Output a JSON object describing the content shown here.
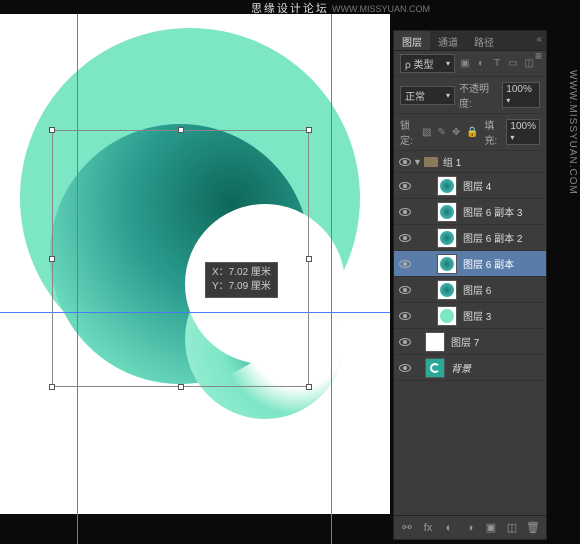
{
  "watermark": {
    "main": "思缘设计论坛",
    "sub": "WWW.MISSYUAN.COM",
    "side": "WWW.MISSYUAN.COM"
  },
  "transform_info": {
    "x_label": "X：7.02 厘米",
    "y_label": "Y：7.09 厘米"
  },
  "panel": {
    "tabs": [
      "图层",
      "通道",
      "路径"
    ],
    "kind_label": "ρ 类型",
    "blend_mode": "正常",
    "opacity_label": "不透明度:",
    "opacity_value": "100%",
    "lock_label": "锁定:",
    "fill_label": "填充:",
    "fill_value": "100%",
    "group_name": "组 1",
    "layers": [
      {
        "name": "图层 4",
        "thumb": "gradient"
      },
      {
        "name": "图层 6 副本 3",
        "thumb": "teal"
      },
      {
        "name": "图层 6 副本 2",
        "thumb": "teal"
      },
      {
        "name": "图层 6 副本",
        "thumb": "teal",
        "selected": true
      },
      {
        "name": "图层 6",
        "thumb": "teal"
      },
      {
        "name": "图层 3",
        "thumb": "lightteal"
      }
    ],
    "outside_layers": [
      {
        "name": "图层 7",
        "thumb": "white"
      },
      {
        "name": "背景",
        "thumb": "swirl",
        "locked": true
      }
    ]
  }
}
